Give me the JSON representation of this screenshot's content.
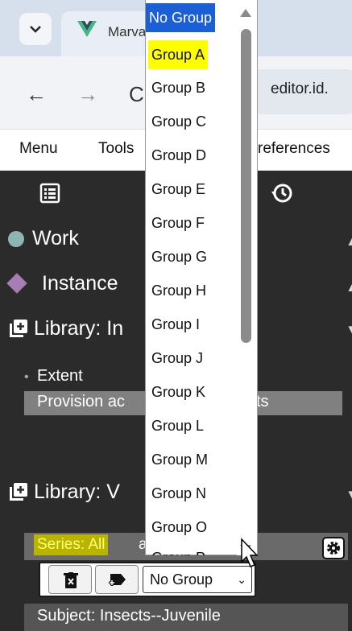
{
  "browser": {
    "tab_title": "Marva",
    "address": "editor.id."
  },
  "menubar": {
    "items": [
      "Menu",
      "Tools",
      "references"
    ]
  },
  "editor": {
    "rows": {
      "work": "Work",
      "instance": "Instance",
      "library_1": "Library: In",
      "extent": "Extent",
      "provision": "Provision ac",
      "provision_tail": "ts",
      "library_2": "Library: V",
      "series": "Series: All",
      "series_tail": "a",
      "subject": "Subject: Insects--Juvenile"
    },
    "group_select_value": "No Group"
  },
  "dropdown": {
    "options": [
      "No Group",
      "Group A",
      "Group B",
      "Group C",
      "Group D",
      "Group E",
      "Group F",
      "Group G",
      "Group H",
      "Group I",
      "Group J",
      "Group K",
      "Group L",
      "Group M",
      "Group N",
      "Group O",
      "Group P"
    ],
    "selected_index": 0,
    "highlighted_index": 1
  },
  "colors": {
    "editor_bg": "#2b2b2b",
    "selected_option": "#1b5fd6",
    "highlight_option": "#ffff00",
    "work_dot": "#8fb5b3",
    "instance_diamond": "#a77db4",
    "series_highlight": "#b8b400"
  }
}
